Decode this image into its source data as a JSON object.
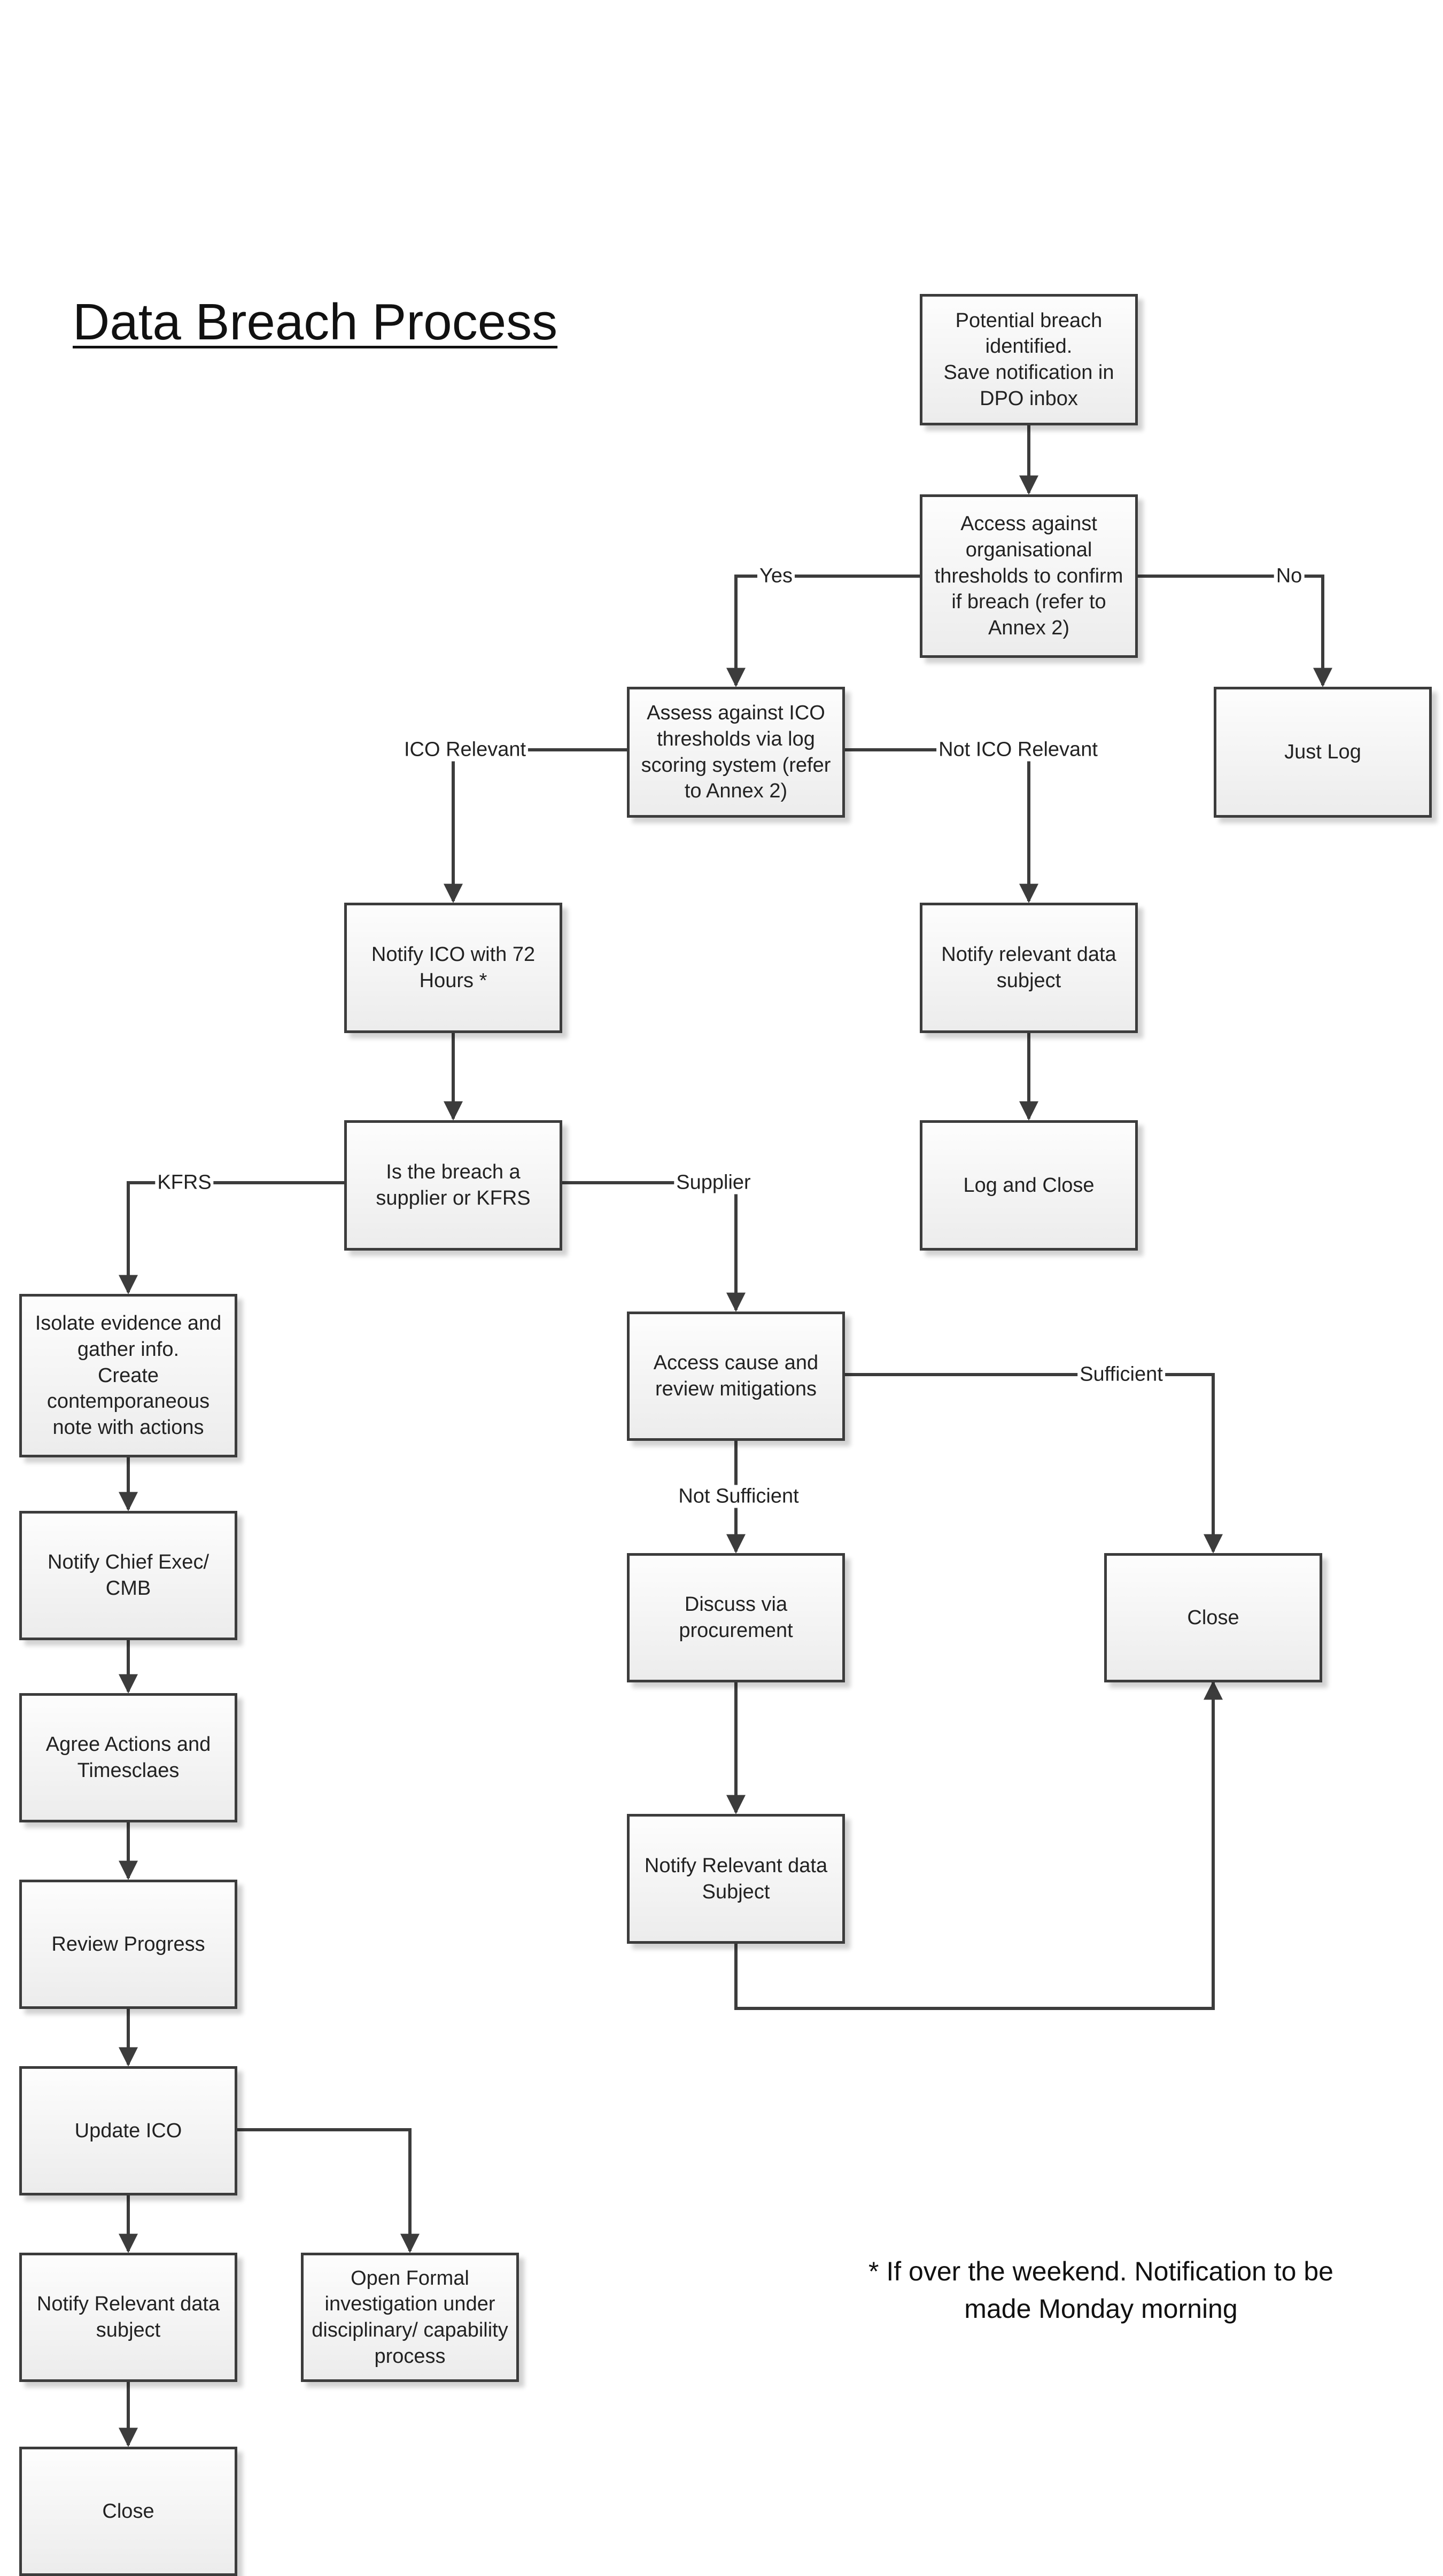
{
  "title": "Data Breach Process",
  "nodes": {
    "potential_breach": "Potential breach identified.\nSave notification in DPO inbox",
    "assess_org": "Access against organisational thresholds to confirm if breach (refer to Annex 2)",
    "just_log": "Just Log",
    "assess_ico": "Assess against ICO thresholds via log scoring system (refer to Annex 2)",
    "notify_ico": "Notify ICO with 72 Hours *",
    "notify_subject_right": "Notify relevant data subject",
    "log_close": "Log and Close",
    "supplier_or_kfrs": "Is the breach a supplier or KFRS",
    "isolate_evidence": "Isolate evidence and gather info.\nCreate contemporaneous note with actions",
    "access_cause": "Access cause and review mitigations",
    "notify_chief": "Notify Chief Exec/ CMB",
    "discuss_procurement": "Discuss via procurement",
    "close_supplier": "Close",
    "agree_actions": "Agree Actions and Timesclaes",
    "notify_subject_supplier": "Notify Relevant data Subject",
    "review_progress": "Review Progress",
    "update_ico": "Update ICO",
    "notify_subject_kfrs": "Notify Relevant data subject",
    "open_investigation": "Open Formal investigation under disciplinary/ capability process",
    "close_final": "Close"
  },
  "edge_labels": {
    "yes": "Yes",
    "no": "No",
    "ico_relevant": "ICO Relevant",
    "not_ico_relevant": "Not ICO Relevant",
    "kfrs": "KFRS",
    "supplier": "Supplier",
    "sufficient": "Sufficient",
    "not_sufficient": "Not Sufficient"
  },
  "footnote": "* If over the weekend. Notification to be\nmade Monday morning"
}
